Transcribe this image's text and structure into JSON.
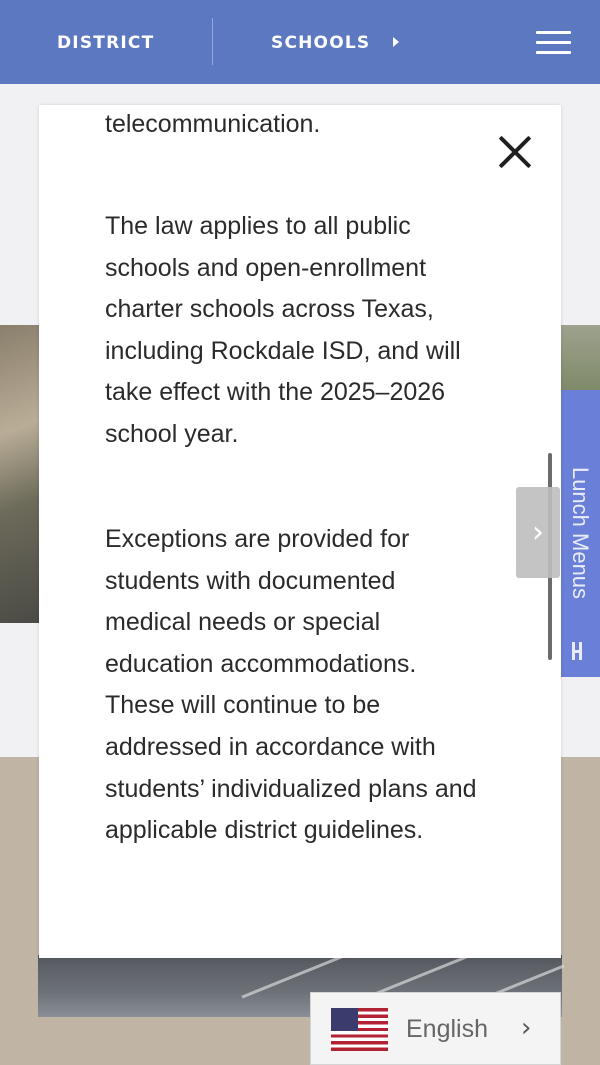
{
  "nav": {
    "district_label": "DISTRICT",
    "schools_label": "SCHOOLS",
    "colors": {
      "bar": "#5b78c0",
      "text": "#ffffff"
    }
  },
  "side_tab": {
    "label": "Lunch Menus",
    "color": "#6a80d8"
  },
  "modal": {
    "paragraphs": [
      "telecommunication.",
      "The law applies to all public schools and open-enrollment charter schools across Texas, including Rockdale ISD, and will take effect with the 2025–2026 school year.",
      "Exceptions are provided for students with documented medical needs or special education accommodations. These will continue to be addressed in accordance with students’ individualized plans and applicable district guidelines."
    ]
  },
  "carousel": {
    "next_glyph": "›"
  },
  "language": {
    "selected": "English",
    "chevron_glyph": "›"
  },
  "icons": [
    "menu-icon",
    "close-icon",
    "chevron-right-icon",
    "us-flag-icon",
    "fork-knife-icon"
  ]
}
